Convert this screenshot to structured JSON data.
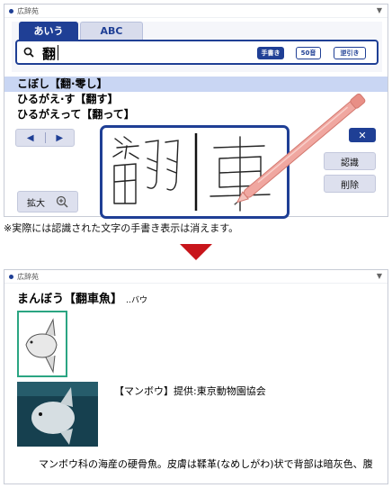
{
  "panel1": {
    "title": "広辞苑",
    "tabs": [
      {
        "label": "あいう",
        "active": true
      },
      {
        "label": "ABC",
        "active": false
      }
    ],
    "search": {
      "value": "翻",
      "buttons": {
        "handwriting": "手書き",
        "fifty_sound": "50音",
        "reverse": "逆引き"
      }
    },
    "results": [
      {
        "text": "こぼし【翻·零し】",
        "selected": true
      },
      {
        "text": "ひるがえ·す【翻す】",
        "selected": false
      },
      {
        "text": "ひるがえって【翻って】",
        "selected": false
      }
    ],
    "nav": {
      "prev": "◀",
      "next": "▶"
    },
    "zoom_label": "拡大",
    "side_buttons": {
      "close": "✕",
      "recognize": "認識",
      "delete": "削除"
    },
    "handwriting_chars": [
      "翻",
      "車"
    ]
  },
  "note": "※実際には認識された文字の手書き表示は消えます。",
  "panel2": {
    "title": "広辞苑",
    "headword": "まんぼう【翻車魚】",
    "reading": "‥バウ",
    "caption": "【マンボウ】提供:東京動物園協会",
    "definition": "マンボウ科の海産の硬骨魚。皮膚は鞣革(なめしがわ)状で背部は暗灰色、腹"
  },
  "colors": {
    "accent": "#1f3f95",
    "selected_row": "#c9d6f3",
    "arrow": "#c8151b",
    "thumb_border": "#2aa582"
  },
  "icons": [
    "search-icon",
    "zoom-in-icon",
    "pen-icon",
    "chevron-down-icon",
    "close-icon"
  ]
}
